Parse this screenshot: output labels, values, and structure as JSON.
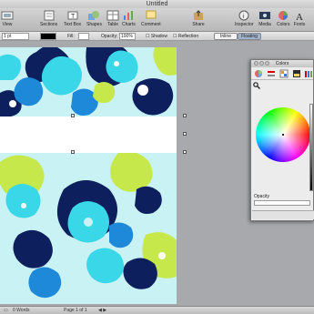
{
  "window": {
    "title": "Untitled"
  },
  "toolbar": {
    "items": [
      {
        "label": "View",
        "icon": "view-icon"
      },
      {
        "label": "Sections",
        "icon": "sections-icon"
      },
      {
        "label": "Text Box",
        "icon": "text-box-icon"
      },
      {
        "label": "Shapes",
        "icon": "shapes-icon"
      },
      {
        "label": "Table",
        "icon": "table-icon"
      },
      {
        "label": "Charts",
        "icon": "charts-icon"
      },
      {
        "label": "Comment",
        "icon": "comment-icon"
      },
      {
        "label": "Share",
        "icon": "share-icon"
      },
      {
        "label": "Inspector",
        "icon": "inspector-icon"
      },
      {
        "label": "Media",
        "icon": "media-icon"
      },
      {
        "label": "Colors",
        "icon": "colors-icon"
      },
      {
        "label": "Fonts",
        "icon": "fonts-icon"
      }
    ]
  },
  "formatbar": {
    "stroke_value": "1 pt",
    "fill_label": "Fill:",
    "opacity_label": "Opacity:",
    "opacity_value": "100%",
    "shadow_label": "Shadow",
    "reflection_label": "Reflection",
    "wrap_inline": "Inline",
    "wrap_floating": "Floating"
  },
  "statusbar": {
    "words": "0 Words",
    "page": "Page 1 of 1"
  },
  "colors_panel": {
    "title": "Colors",
    "opacity_label": "Opacity"
  },
  "palette": {
    "navy": "#0d1f5c",
    "cyan": "#3ad7e8",
    "lime": "#c7e84a",
    "blue": "#1e88d9",
    "pale": "#c9f2f5",
    "white": "#ffffff"
  }
}
